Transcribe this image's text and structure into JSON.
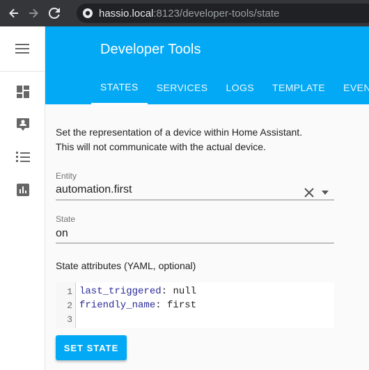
{
  "browser": {
    "url_host": "hassio.local",
    "url_path": ":8123/developer-tools/state"
  },
  "sidebar": {
    "items": [
      {
        "icon": "menu-icon"
      },
      {
        "icon": "dashboard-icon"
      },
      {
        "icon": "account-box-icon"
      },
      {
        "icon": "list-icon"
      },
      {
        "icon": "chart-icon"
      }
    ]
  },
  "header": {
    "title": "Developer Tools",
    "tabs": [
      {
        "label": "STATES",
        "active": true
      },
      {
        "label": "SERVICES"
      },
      {
        "label": "LOGS"
      },
      {
        "label": "TEMPLATE"
      },
      {
        "label": "EVENTS"
      }
    ]
  },
  "content": {
    "description_line1": "Set the representation of a device within Home Assistant.",
    "description_line2": "This will not communicate with the actual device.",
    "entity": {
      "label": "Entity",
      "value": "automation.first"
    },
    "state": {
      "label": "State",
      "value": "on"
    },
    "attributes_label": "State attributes (YAML, optional)",
    "code_lines": [
      {
        "num": "1",
        "key": "last_triggered",
        "value": "null"
      },
      {
        "num": "2",
        "key": "friendly_name",
        "value": "first"
      },
      {
        "num": "3",
        "key": "",
        "value": ""
      }
    ],
    "set_state_label": "SET STATE"
  },
  "colors": {
    "accent": "#03a9f4",
    "browser_bg": "#35363a"
  }
}
